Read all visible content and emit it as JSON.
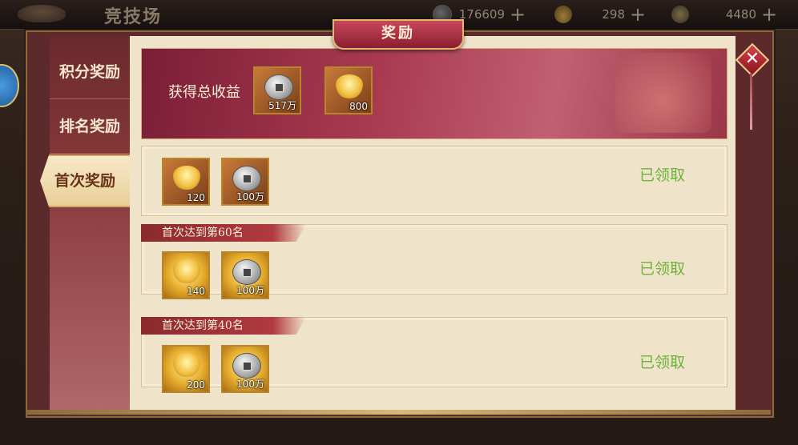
{
  "topbar": {
    "scene_title": "竞技场",
    "resources": [
      {
        "icon": "silver-coin-icon",
        "value": "176609"
      },
      {
        "icon": "gold-ingot-icon",
        "value": "298"
      },
      {
        "icon": "ticket-icon",
        "value": "4480"
      }
    ],
    "plus_label": "+"
  },
  "dialog": {
    "title": "奖励",
    "close_label": "✕"
  },
  "sidebar": {
    "tabs": [
      {
        "label": "积分奖励",
        "active": false
      },
      {
        "label": "排名奖励",
        "active": false
      },
      {
        "label": "首次奖励",
        "active": true
      }
    ]
  },
  "summary": {
    "label": "获得总收益",
    "items": [
      {
        "icon": "silver-coin-icon",
        "qty": "517万"
      },
      {
        "icon": "gold-ingot-icon",
        "qty": "800"
      }
    ]
  },
  "reward_rows": [
    {
      "header": "",
      "items": [
        {
          "icon": "gold-ingot-icon",
          "qty": "120",
          "frame": "bronze"
        },
        {
          "icon": "silver-coin-icon",
          "qty": "100万",
          "frame": "bronze"
        }
      ],
      "status": "已领取"
    },
    {
      "header": "首次达到第60名",
      "items": [
        {
          "icon": "gold-ingot-icon",
          "qty": "140",
          "frame": "gold"
        },
        {
          "icon": "silver-coin-icon",
          "qty": "100万",
          "frame": "gold"
        }
      ],
      "status": "已领取"
    },
    {
      "header": "首次达到第40名",
      "items": [
        {
          "icon": "gold-ingot-icon",
          "qty": "200",
          "frame": "gold"
        },
        {
          "icon": "silver-coin-icon",
          "qty": "100万",
          "frame": "gold"
        }
      ],
      "status": "已领取"
    }
  ],
  "colors": {
    "claimed": "#6fb23a",
    "tab_active_bg": "#f7e9c8",
    "banner": "#a83a50"
  }
}
